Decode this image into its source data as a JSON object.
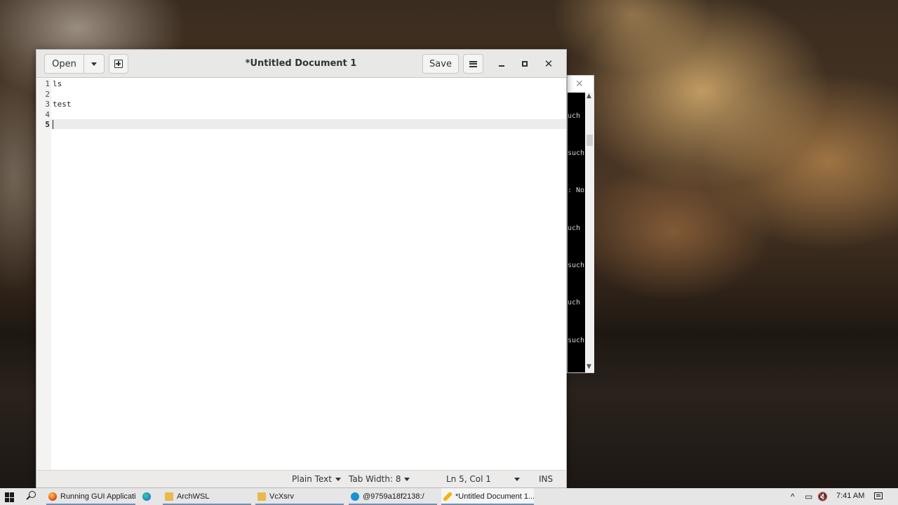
{
  "desktop": {
    "wallpaper": "stormy clouds"
  },
  "gedit": {
    "title": "*Untitled Document 1",
    "header": {
      "open_label": "Open",
      "save_label": "Save"
    },
    "lines": [
      {
        "number": "1",
        "text": "ls"
      },
      {
        "number": "2",
        "text": ""
      },
      {
        "number": "3",
        "text": "test"
      },
      {
        "number": "4",
        "text": ""
      },
      {
        "number": "5",
        "text": ""
      }
    ],
    "status": {
      "language": "Plain Text",
      "tab_width": "Tab Width: 8",
      "position": "Ln 5, Col 1",
      "mode": "INS"
    }
  },
  "terminal": {
    "lines": [
      "uch",
      "such",
      ": No",
      "uch",
      "such",
      "uch",
      "such"
    ]
  },
  "taskbar": {
    "apps": [
      {
        "label": "Running GUI Applicati...",
        "icon": "firefox-icon"
      },
      {
        "label": "",
        "icon": "edge-icon"
      },
      {
        "label": "ArchWSL",
        "icon": "folder-icon"
      },
      {
        "label": "VcXsrv",
        "icon": "folder-icon"
      },
      {
        "label": "@9759a18f2138:/",
        "icon": "arch-icon"
      },
      {
        "label": "*Untitled Document 1...",
        "icon": "text-editor-icon"
      }
    ],
    "tray": {
      "chevron": "^",
      "volume": "muted"
    },
    "clock": "7:41 AM"
  }
}
